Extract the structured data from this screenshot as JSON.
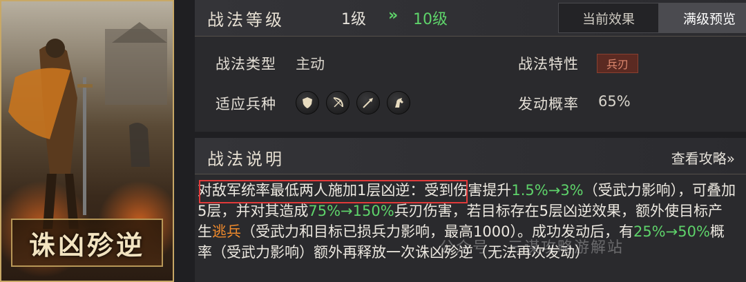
{
  "skill_card": {
    "name": "诛凶殄逆"
  },
  "header": {
    "title": "战法等级",
    "level_from": "1级",
    "level_arrow": "»",
    "level_to": "10级",
    "tabs": [
      {
        "label": "当前效果",
        "active": false
      },
      {
        "label": "满级预览",
        "active": true
      }
    ]
  },
  "properties": {
    "type_label": "战法类型",
    "type_value": "主动",
    "feature_label": "战法特性",
    "feature_value": "兵刃",
    "troops_label": "适应兵种",
    "troops": [
      "shield-troop-icon",
      "bow-troop-icon",
      "spear-troop-icon",
      "cavalry-troop-icon"
    ],
    "rate_label": "发动概率",
    "rate_value": "65%"
  },
  "description": {
    "title": "战法说明",
    "guide_link": "查看攻略»",
    "segments": [
      {
        "text": "对敌军统率最低两人施加1层凶逆",
        "color": "white"
      },
      {
        "text": "：受到伤害提升",
        "color": "white"
      },
      {
        "text": "1.5%→3%",
        "color": "green"
      },
      {
        "text": "（受武力影响），可叠加5层，并对其造成",
        "color": "white"
      },
      {
        "text": "75%→150%",
        "color": "green"
      },
      {
        "text": "兵刃伤害，若目标存在5层凶逆效果，额外使目标产生",
        "color": "white"
      },
      {
        "text": "逃兵",
        "color": "orange"
      },
      {
        "text": "（受武力和目标已损兵力影响，最高1000）。成功发动后，有",
        "color": "white"
      },
      {
        "text": "25%→50%",
        "color": "green"
      },
      {
        "text": "概率（受武力影响）额外再释放一次诛凶殄逆（无法再次发动）",
        "color": "white"
      }
    ],
    "watermark": "公众号 · 三谋攻略游解站"
  },
  "colors": {
    "accent_green": "#5ed36a",
    "accent_orange": "#f08a2c",
    "highlight_box": "#e23a3a",
    "badge_bg": "#5b2a22"
  }
}
